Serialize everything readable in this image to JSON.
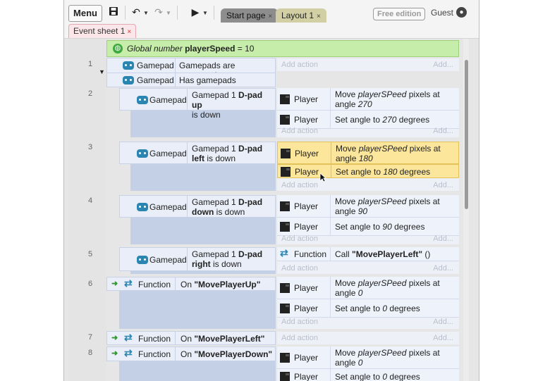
{
  "toolbar": {
    "menu_label": "Menu",
    "tabs": [
      {
        "label": "Start page",
        "close": "×"
      },
      {
        "label": "Layout 1",
        "close": "×"
      }
    ],
    "edition_badge": "Free edition",
    "user_label": "Guest"
  },
  "sheet_tab": {
    "label": "Event sheet 1",
    "close": "×"
  },
  "global": {
    "prefix": "Global number",
    "name": "playerSpeed",
    "suffix": "= 10"
  },
  "events": [
    {
      "number": "1",
      "conditions": [
        {
          "object": "Gamepad",
          "text": "Gamepads are supported"
        },
        {
          "object": "Gamepad",
          "text": "Has gamepads"
        }
      ],
      "add_action": "Add action",
      "add_more": "Add..."
    },
    {
      "number": "2",
      "condition": {
        "object": "Gamepad",
        "line1": "Gamepad 1 ",
        "line1_bold": "D-pad up",
        "line2": "is down"
      },
      "actions": [
        {
          "object": "Player",
          "text": "Move ",
          "italic": "playerSPeed",
          "text2": " pixels at angle ",
          "value": "270"
        },
        {
          "object": "Player",
          "text": "Set angle to ",
          "value": "270",
          "text2": " degrees"
        }
      ]
    },
    {
      "number": "3",
      "condition": {
        "object": "Gamepad",
        "line1": "Gamepad 1 ",
        "line1_bold": "D-pad",
        "line2_bold": "left",
        "line2": " is down"
      },
      "actions": [
        {
          "object": "Player",
          "text": "Move ",
          "italic": "playerSPeed",
          "text2": " pixels at angle ",
          "value": "180"
        },
        {
          "object": "Player",
          "text": "Set angle to ",
          "value": "180",
          "text2": " degrees"
        }
      ]
    },
    {
      "number": "4",
      "condition": {
        "object": "Gamepad",
        "line1": "Gamepad 1 ",
        "line1_bold": "D-pad",
        "line2_bold": "down",
        "line2": " is down"
      },
      "actions": [
        {
          "object": "Player",
          "text": "Move ",
          "italic": "playerSPeed",
          "text2": " pixels at angle ",
          "value": "90"
        },
        {
          "object": "Player",
          "text": "Set angle to ",
          "value": "90",
          "text2": " degrees"
        }
      ]
    },
    {
      "number": "5",
      "condition": {
        "object": "Gamepad",
        "line1": "Gamepad 1 ",
        "line1_bold": "D-pad",
        "line2_bold": "right",
        "line2": " is down"
      },
      "actions": [
        {
          "object": "Function",
          "text": "Call ",
          "bold": "\"MovePlayerLeft\"",
          "text2": " ()"
        }
      ]
    },
    {
      "number": "6",
      "condition": {
        "object": "Function",
        "text": "On ",
        "bold": "\"MovePlayerUp\""
      },
      "actions": [
        {
          "object": "Player",
          "text": "Move ",
          "italic": "playerSPeed",
          "text2": " pixels at angle ",
          "value": "0"
        },
        {
          "object": "Player",
          "text": "Set angle to ",
          "value": "0",
          "text2": " degrees"
        }
      ]
    },
    {
      "number": "7",
      "condition": {
        "object": "Function",
        "text": "On ",
        "bold": "\"MovePlayerLeft\""
      }
    },
    {
      "number": "8",
      "condition": {
        "object": "Function",
        "text": "On ",
        "bold": "\"MovePlayerDown\""
      },
      "actions": [
        {
          "object": "Player",
          "text": "Move ",
          "italic": "playerSPeed",
          "text2": " pixels at angle ",
          "value": "0"
        },
        {
          "object": "Player",
          "text": "Set angle to ",
          "value": "0",
          "text2": " degrees"
        }
      ]
    }
  ],
  "add_action_label": "Add action",
  "add_more_label": "Add..."
}
